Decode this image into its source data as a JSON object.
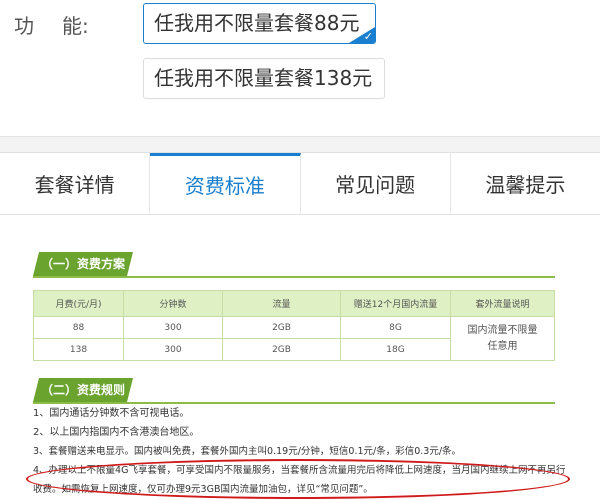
{
  "function_label": {
    "first": "功",
    "second": "能:"
  },
  "options": [
    {
      "label": "任我用不限量套餐88元",
      "selected": true
    },
    {
      "label": "任我用不限量套餐138元",
      "selected": false
    }
  ],
  "tabs": [
    {
      "label": "套餐详情"
    },
    {
      "label": "资费标准",
      "active": true
    },
    {
      "label": "常见问题"
    },
    {
      "label": "温馨提示"
    }
  ],
  "section1": {
    "title": "（一）资费方案",
    "headers": [
      "月费(元/月)",
      "分钟数",
      "流量",
      "赠送12个月国内流量",
      "套外流量说明"
    ],
    "rows": [
      [
        "88",
        "300",
        "2GB",
        "8G"
      ],
      [
        "138",
        "300",
        "2GB",
        "18G"
      ]
    ],
    "merged_note_line1": "国内流量不限量",
    "merged_note_line2": "任意用"
  },
  "section2": {
    "title": "（二）资费规则",
    "rules": [
      "1、国内通话分钟数不含可视电话。",
      "2、以上国内指国内不含港澳台地区。",
      "3、套餐赠送来电显示。国内被叫免费，套餐外国内主叫0.19元/分钟，短信0.1元/条，彩信0.3元/条。",
      "4、办理以上不限量4G飞享套餐，可享受国内不限量服务，当套餐所含流量用完后将降低上网速度，当月国内继续上网不再另行收费。如需恢复上网速度，仅可办理9元3GB国内流量加油包，详见“常见问题”。"
    ]
  },
  "colors": {
    "accent": "#1a7fcf",
    "green": "#6aa32e",
    "highlight": "#d01a1a"
  }
}
